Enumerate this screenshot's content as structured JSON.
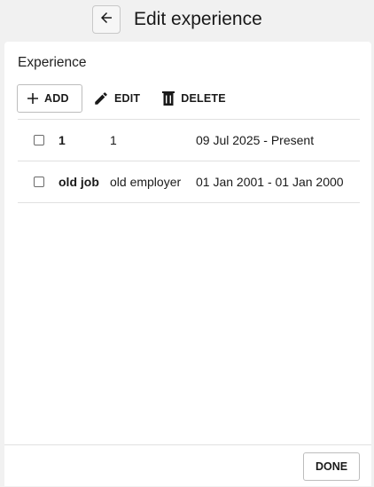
{
  "header": {
    "back_icon": "arrow-left-icon",
    "title": "Edit experience"
  },
  "section": {
    "title": "Experience"
  },
  "toolbar": {
    "add_label": "ADD",
    "add_icon": "plus-icon",
    "edit_label": "EDIT",
    "edit_icon": "pencil-icon",
    "delete_label": "DELETE",
    "delete_icon": "trash-icon"
  },
  "experiences": [
    {
      "checked": false,
      "title": "1",
      "employer": "1",
      "dates": "09 Jul 2025 - Present"
    },
    {
      "checked": false,
      "title": "old job",
      "employer": "old employer",
      "dates": "01 Jan 2001 - 01 Jan 2000"
    }
  ],
  "footer": {
    "done_label": "DONE"
  }
}
